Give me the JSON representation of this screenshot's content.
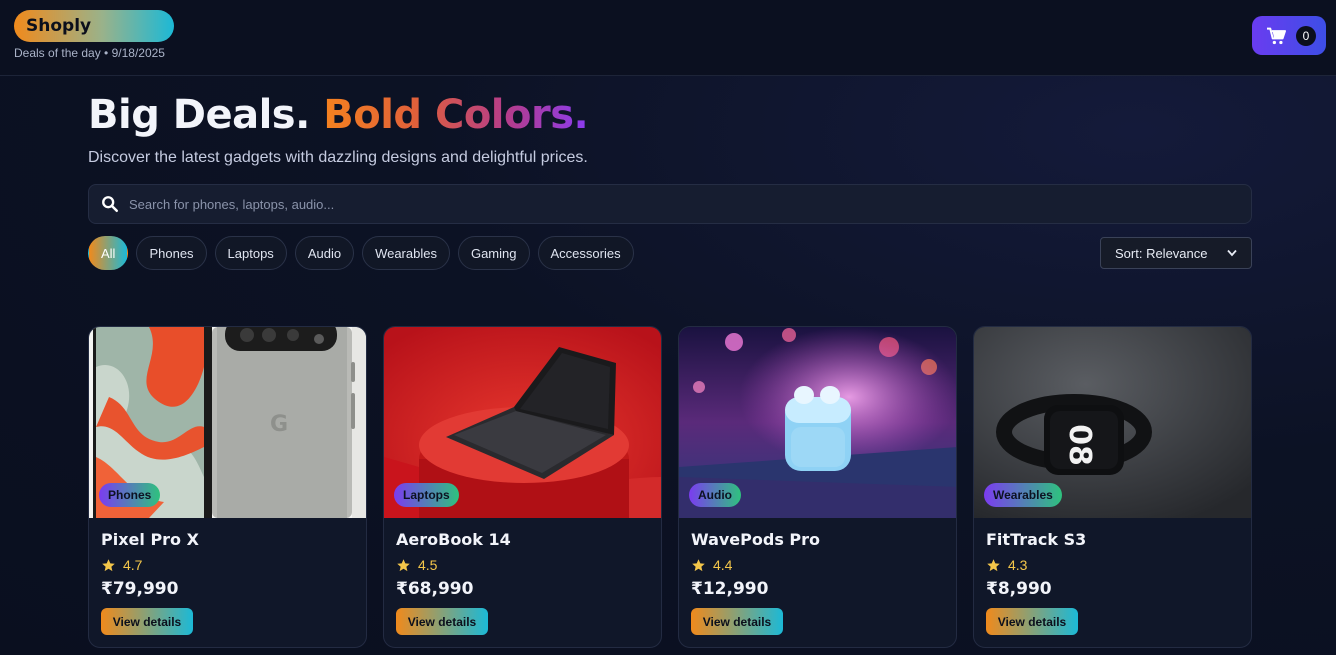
{
  "header": {
    "logo": "Shoply",
    "tagline": "Deals of the day • 9/18/2025",
    "cart_count": "0"
  },
  "hero": {
    "title_plain": "Big Deals. ",
    "title_gradient": "Bold Colors.",
    "subtitle": "Discover the latest gadgets with dazzling designs and delightful prices."
  },
  "search": {
    "placeholder": "Search for phones, laptops, audio..."
  },
  "filters": [
    "All",
    "Phones",
    "Laptops",
    "Audio",
    "Wearables",
    "Gaming",
    "Accessories"
  ],
  "active_filter": "All",
  "sort": {
    "selected": "Sort: Relevance"
  },
  "products": [
    {
      "name": "Pixel Pro X",
      "category": "Phones",
      "rating": "4.7",
      "price": "₹79,990",
      "cta": "View details"
    },
    {
      "name": "AeroBook 14",
      "category": "Laptops",
      "rating": "4.5",
      "price": "₹68,990",
      "cta": "View details"
    },
    {
      "name": "WavePods Pro",
      "category": "Audio",
      "rating": "4.4",
      "price": "₹12,990",
      "cta": "View details"
    },
    {
      "name": "FitTrack S3",
      "category": "Wearables",
      "rating": "4.3",
      "price": "₹8,990",
      "cta": "View details"
    }
  ],
  "colors": {
    "accent_orange": "#f08a1c",
    "accent_cyan": "#1cb9d6",
    "cart_purple": "#6a3cf0",
    "star": "#f3c64a",
    "background": "#0b1020"
  }
}
